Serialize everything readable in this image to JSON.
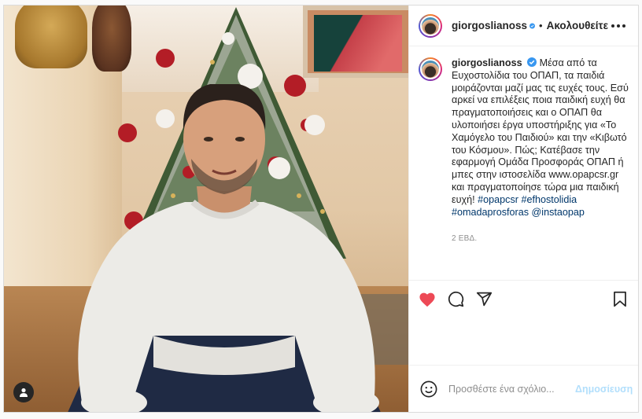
{
  "post": {
    "author": {
      "username": "giorgoslianoss",
      "verified": true,
      "follow_label": "Ακολουθείτε",
      "separator": "•"
    },
    "caption": {
      "text": "Μέσα από τα Ευχοστολίδια του ΟΠΑΠ, τα παιδιά μοιράζονται μαζί μας τις ευχές τους. Εσύ αρκεί να επιλέξεις ποια παιδική ευχή θα πραγματοποιήσεις και ο ΟΠΑΠ θα υλοποιήσει έργα υποστήριξης για «Το Χαμόγελο του Παιδιού» και την «Κιβωτό του Κόσμου». Πώς; Κατέβασε την εφαρμογή Ομάδα Προσφοράς ΟΠΑΠ ή μπες στην ιστοσελίδα www.opapcsr.gr και πραγματοποίησε τώρα μια παιδική ευχή!",
      "hashtags": [
        "#opapcsr",
        "#efhostolidia",
        "#omadaprosforas"
      ],
      "mention": "@instaopap"
    },
    "time_ago": "2 ΕΒΔ.",
    "liked": true
  },
  "icons": {
    "more": "more-options-icon",
    "like": "heart-icon",
    "comment": "comment-icon",
    "share": "paper-plane-icon",
    "save": "bookmark-icon",
    "emoji": "emoji-icon",
    "tag_user": "user-tag-icon",
    "verified": "verified-badge-icon"
  },
  "comment_box": {
    "placeholder": "Προσθέστε ένα σχόλιο...",
    "post_label": "Δημοσίευση"
  },
  "colors": {
    "like_red": "#ed4956",
    "verified_blue": "#3897f0",
    "hashtag_blue": "#00376b",
    "post_button_disabled": "#b2dffc"
  }
}
